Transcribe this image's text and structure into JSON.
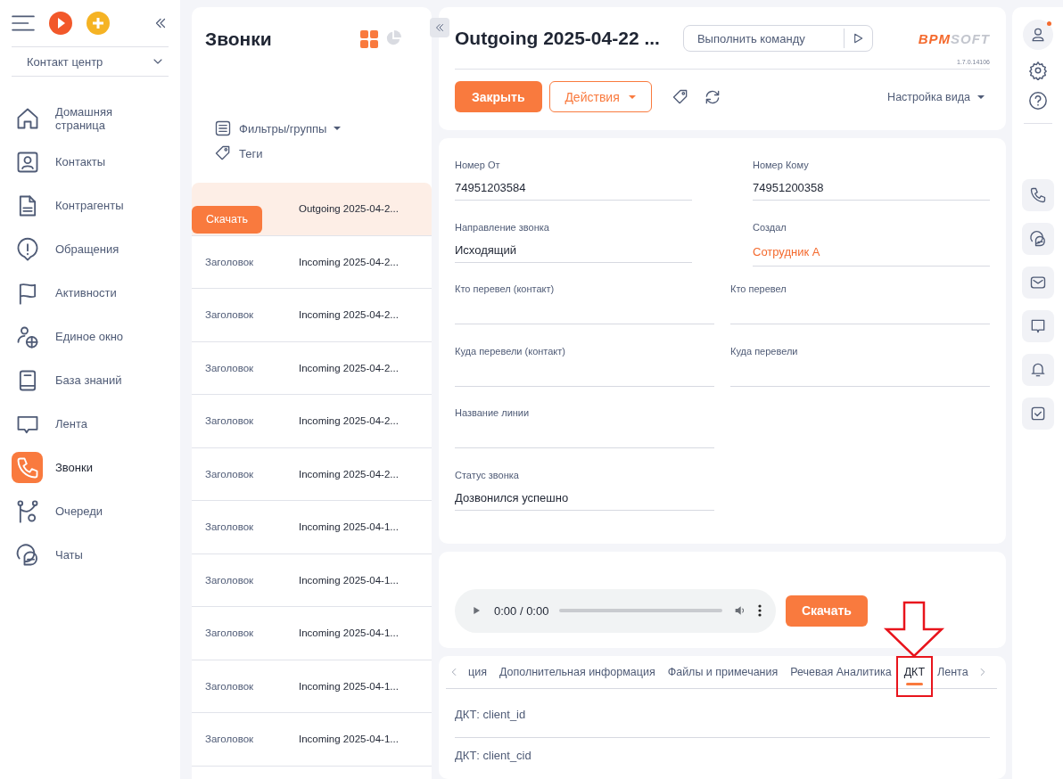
{
  "sidebar": {
    "section_select": "Контакт центр",
    "items": [
      {
        "label": "Домашняя страница",
        "selected": false
      },
      {
        "label": "Контакты",
        "selected": false
      },
      {
        "label": "Контрагенты",
        "selected": false
      },
      {
        "label": "Обращения",
        "selected": false
      },
      {
        "label": "Активности",
        "selected": false
      },
      {
        "label": "Единое окно",
        "selected": false
      },
      {
        "label": "База знаний",
        "selected": false
      },
      {
        "label": "Лента",
        "selected": false
      },
      {
        "label": "Звонки",
        "selected": true
      },
      {
        "label": "Очереди",
        "selected": false
      },
      {
        "label": "Чаты",
        "selected": false
      }
    ]
  },
  "list": {
    "title": "Звонки",
    "filters": "Фильтры/группы",
    "tags": "Теги",
    "row_button": "Скачать",
    "rows": [
      {
        "column_2": "Outgoing 2025-04-2...",
        "selected": true
      },
      {
        "column_1": "Заголовок",
        "column_2": "Incoming 2025-04-2...",
        "selected": false
      },
      {
        "column_1": "Заголовок",
        "column_2": "Incoming 2025-04-2...",
        "selected": false
      },
      {
        "column_1": "Заголовок",
        "column_2": "Incoming 2025-04-2...",
        "selected": false
      },
      {
        "column_1": "Заголовок",
        "column_2": "Incoming 2025-04-2...",
        "selected": false
      },
      {
        "column_1": "Заголовок",
        "column_2": "Incoming 2025-04-2...",
        "selected": false
      },
      {
        "column_1": "Заголовок",
        "column_2": "Incoming 2025-04-1...",
        "selected": false
      },
      {
        "column_1": "Заголовок",
        "column_2": "Incoming 2025-04-1...",
        "selected": false
      },
      {
        "column_1": "Заголовок",
        "column_2": "Incoming 2025-04-1...",
        "selected": false
      },
      {
        "column_1": "Заголовок",
        "column_2": "Incoming 2025-04-1...",
        "selected": false
      },
      {
        "column_1": "Заголовок",
        "column_2": "Incoming 2025-04-1...",
        "selected": false
      }
    ]
  },
  "record": {
    "title": "Outgoing 2025-04-22 ...",
    "command_placeholder": "Выполнить команду",
    "logo": {
      "part_1": "BPM",
      "part_2": "SOFT"
    },
    "version": "1.7.0.14106",
    "close_button": "Закрыть",
    "actions_button": "Действия",
    "view_settings": "Настройка вида"
  },
  "fields": [
    [
      {
        "label": "Номер От",
        "value": "74951203584"
      },
      {
        "label": "Номер Кому",
        "value": "74951200358"
      }
    ],
    [
      {
        "label": "Направление звонка",
        "value": "Исходящий"
      },
      {
        "label": "Создал",
        "value": "Сотрудник А",
        "link": true
      }
    ],
    [
      {
        "label": "Кто перевел (контакт)"
      },
      {
        "label": "Кто перевел"
      }
    ],
    [
      {
        "label": "Куда перевели (контакт)"
      },
      {
        "label": "Куда перевели"
      }
    ],
    [
      {
        "label": "Название линии"
      }
    ],
    [
      {
        "label": "Статус звонка",
        "value": "Дозвонился успешно"
      }
    ]
  ],
  "player": {
    "time": "0:00 / 0:00",
    "download_button": "Скачать"
  },
  "tabs": [
    {
      "label": "ция",
      "selected": false,
      "highlighted": false
    },
    {
      "label": "Дополнительная информация",
      "selected": false,
      "highlighted": false
    },
    {
      "label": "Файлы и примечания",
      "selected": false,
      "highlighted": false
    },
    {
      "label": "Речевая Аналитика",
      "selected": false,
      "highlighted": false
    },
    {
      "label": "ДКТ",
      "selected": true,
      "highlighted": true
    },
    {
      "label": "Лента",
      "selected": false,
      "highlighted": false
    }
  ],
  "tab_fields": [
    {
      "label": "ДКТ: client_id"
    },
    {
      "label": "ДКТ: client_cid"
    }
  ]
}
